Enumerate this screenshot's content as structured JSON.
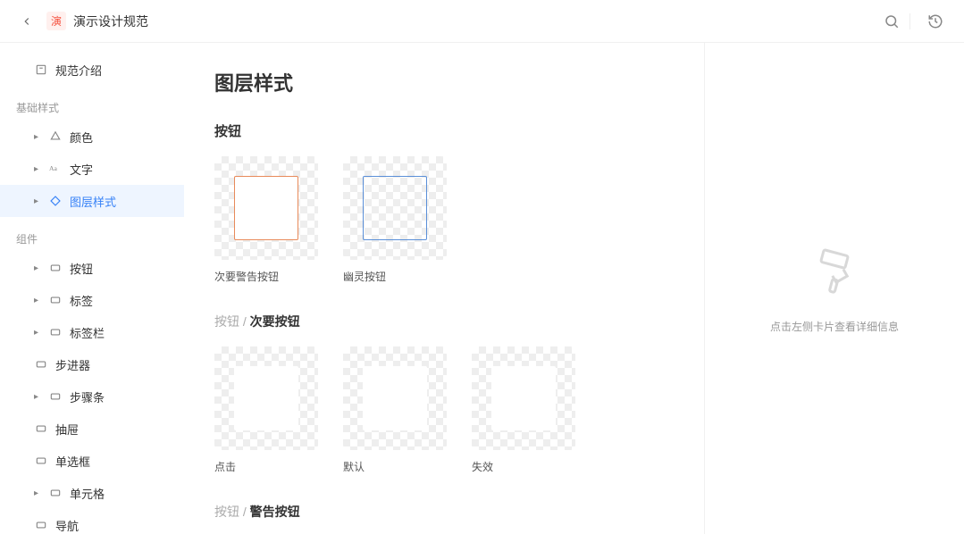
{
  "header": {
    "badge": "演",
    "title": "演示设计规范"
  },
  "sidebar": {
    "intro": "规范介绍",
    "section_basic": "基础样式",
    "section_component": "组件",
    "items_basic": [
      {
        "label": "颜色"
      },
      {
        "label": "文字"
      },
      {
        "label": "图层样式"
      }
    ],
    "items_component": [
      {
        "label": "按钮",
        "caret": true,
        "sub": true
      },
      {
        "label": "标签",
        "caret": true,
        "sub": true
      },
      {
        "label": "标签栏",
        "caret": true,
        "sub": true
      },
      {
        "label": "步进器",
        "caret": false,
        "sub": false
      },
      {
        "label": "步骤条",
        "caret": true,
        "sub": true
      },
      {
        "label": "抽屉",
        "caret": false,
        "sub": false
      },
      {
        "label": "单选框",
        "caret": false,
        "sub": false
      },
      {
        "label": "单元格",
        "caret": true,
        "sub": true
      },
      {
        "label": "导航",
        "caret": false,
        "sub": false
      }
    ]
  },
  "content": {
    "page_title": "图层样式",
    "sec_button": "按钮",
    "cards_button": [
      {
        "label": "次要警告按钮"
      },
      {
        "label": "幽灵按钮"
      }
    ],
    "sub1_muted": "按钮 / ",
    "sub1_strong": "次要按钮",
    "cards_secondary": [
      {
        "label": "点击"
      },
      {
        "label": "默认"
      },
      {
        "label": "失效"
      }
    ],
    "sub2_muted": "按钮 / ",
    "sub2_strong": "警告按钮"
  },
  "right_panel": {
    "hint": "点击左侧卡片查看详细信息"
  }
}
